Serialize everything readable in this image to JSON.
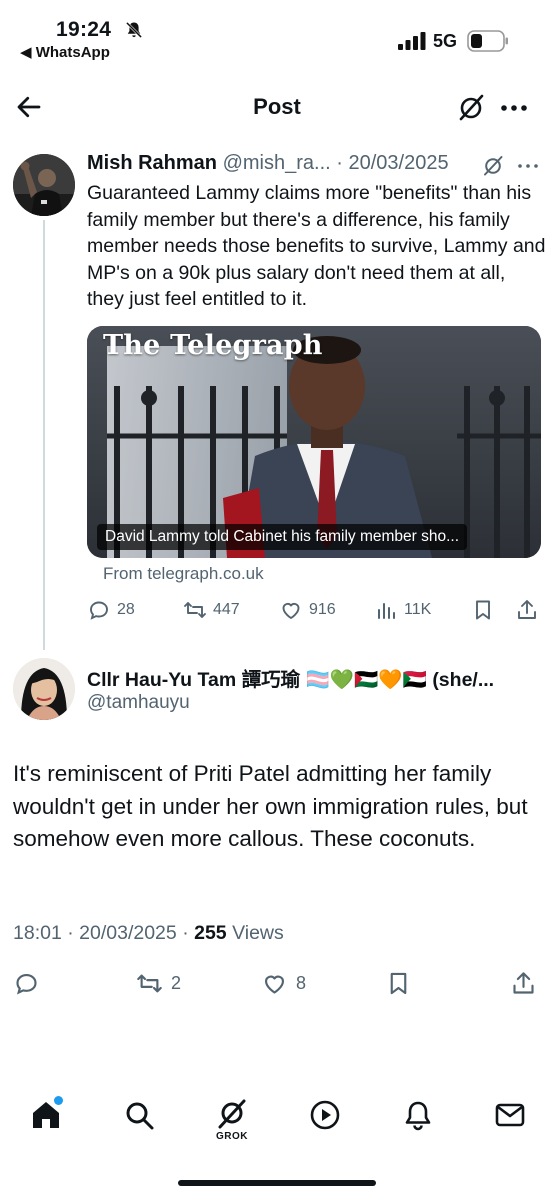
{
  "status_bar": {
    "time": "19:24",
    "back_app": "◀ WhatsApp",
    "network": "5G",
    "icons": [
      "bell-slash-icon",
      "signal-icon",
      "battery-icon"
    ]
  },
  "header": {
    "title": "Post",
    "icons": [
      "back-arrow-icon",
      "grok-icon",
      "more-icon"
    ]
  },
  "quoted_post": {
    "name": "Mish Rahman",
    "handle": "@mish_ra...",
    "separator": "·",
    "date": "20/03/2025",
    "text": "Guaranteed Lammy claims more \"benefits\" than his family member but there's a difference, his family member needs those benefits to survive, Lammy and MP's on a 90k plus salary don't need them at all, they just feel entitled to it.",
    "card": {
      "masthead": "The Telegraph",
      "caption": "David Lammy told Cabinet his family member sho...",
      "source": "From telegraph.co.uk"
    },
    "stats": {
      "replies": "28",
      "reposts": "447",
      "likes": "916",
      "views": "11K"
    }
  },
  "reply_post": {
    "name": "Cllr Hau-Yu Tam 譚巧瑜 🏳️‍⚧️💚🇵🇸🧡🇸🇩 (she/...",
    "handle": "@tamhauyu",
    "text": "It's reminiscent of Priti Patel admitting her family wouldn't get in under her own immigration rules, but somehow even more callous. These coconuts.",
    "time": "18:01",
    "date": "20/03/2025",
    "separator": "·",
    "view_count": "255",
    "views_label": "Views",
    "stats": {
      "reposts": "2",
      "likes": "8"
    }
  },
  "bottom_nav": {
    "grok_label": "GROK",
    "items": [
      "home-icon",
      "search-icon",
      "grok-icon",
      "video-icon",
      "notifications-icon",
      "messages-icon"
    ]
  },
  "colors": {
    "text_primary": "#0f1419",
    "text_secondary": "#536471",
    "accent": "#1d9bf0",
    "divider": "#cfd9de"
  }
}
